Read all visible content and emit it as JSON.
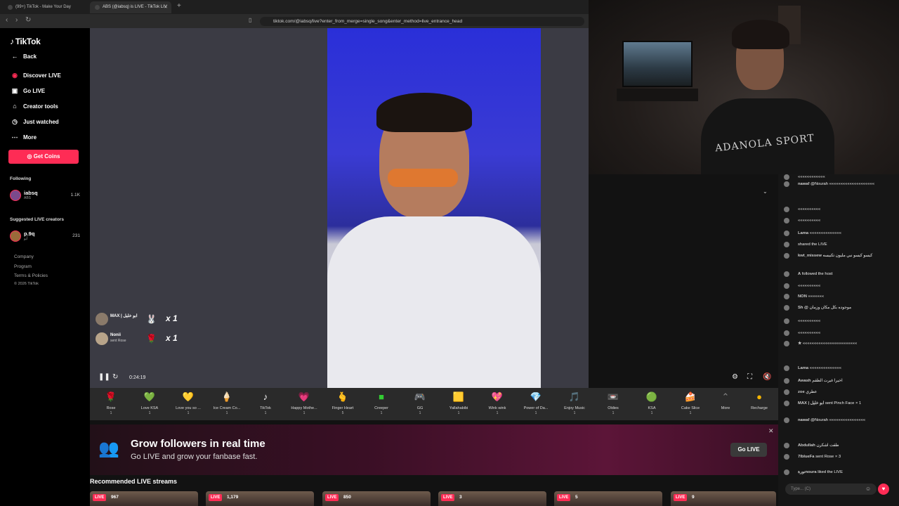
{
  "browser": {
    "tabs": [
      {
        "label": "(99+) TikTok - Make Your Day"
      },
      {
        "label": "ABS (@iabsq) is LIVE - TikTok LIV"
      }
    ],
    "url": "tiktok.com/@iabsq/live?enter_from_merge=single_song&enter_method=live_entrance_head"
  },
  "sidebar": {
    "logo": "TikTok",
    "back": "Back",
    "items": [
      {
        "label": "Discover LIVE",
        "icon": "discover-live-icon"
      },
      {
        "label": "Go LIVE",
        "icon": "camera-icon"
      },
      {
        "label": "Creator tools",
        "icon": "house-icon"
      },
      {
        "label": "Just watched",
        "icon": "clock-icon"
      },
      {
        "label": "More",
        "icon": "dots-icon"
      }
    ],
    "get_coins": "Get Coins",
    "following_title": "Following",
    "following": [
      {
        "name": "iabsq",
        "sub": "ABS",
        "count": "1.1K"
      }
    ],
    "suggested_title": "Suggested LIVE creators",
    "suggested": [
      {
        "name": "p.9q",
        "sub": "أبو",
        "count": "231"
      }
    ],
    "footer": [
      "Company",
      "Program",
      "Terms & Policies",
      "© 2026 TikTok"
    ]
  },
  "player": {
    "gift_popups": [
      {
        "user": "MAX | ابو خليل",
        "sub": "",
        "mult": "x 1"
      },
      {
        "user": "Nonii",
        "sub": "sent Rose",
        "mult": "x 1"
      }
    ],
    "time": "0:24:19"
  },
  "gifts": [
    {
      "label": "Rose",
      "price": "1"
    },
    {
      "label": "Love KSA",
      "price": "1"
    },
    {
      "label": "Love you so ...",
      "price": "1"
    },
    {
      "label": "Ice Cream Co...",
      "price": "1"
    },
    {
      "label": "TikTok",
      "price": "1"
    },
    {
      "label": "Happy Mothe...",
      "price": "1"
    },
    {
      "label": "Finger Heart",
      "price": "5"
    },
    {
      "label": "Creeper",
      "price": "1"
    },
    {
      "label": "GG",
      "price": "1"
    },
    {
      "label": "Yallahabibi",
      "price": "1"
    },
    {
      "label": "Wink wink",
      "price": "1"
    },
    {
      "label": "Power of Da...",
      "price": "1"
    },
    {
      "label": "Enjoy Music",
      "price": "1"
    },
    {
      "label": "Oldies",
      "price": "1"
    },
    {
      "label": "KSA",
      "price": "1"
    },
    {
      "label": "Cake Slice",
      "price": "1"
    }
  ],
  "gift_more": "More",
  "recharge": "Recharge",
  "promo": {
    "title": "Grow followers in real time",
    "subtitle": "Go LIVE and grow your fanbase fast.",
    "button": "Go LIVE"
  },
  "recommended": {
    "title": "Recommended LIVE streams",
    "streams": [
      {
        "badge": "LIVE",
        "viewers": "967"
      },
      {
        "badge": "LIVE",
        "viewers": "1,179"
      },
      {
        "badge": "LIVE",
        "viewers": "850"
      },
      {
        "badge": "LIVE",
        "viewers": "3"
      },
      {
        "badge": "LIVE",
        "viewers": "5"
      },
      {
        "badge": "LIVE",
        "viewers": "9"
      }
    ]
  },
  "webcam": {
    "shirt_text": "ADANOLA SPORT"
  },
  "chat": {
    "messages": [
      {
        "user": "",
        "text": "««««««««««««"
      },
      {
        "user": "nawaf",
        "text": "@Nourah ««««««««««««««««««««"
      },
      {
        "user": "",
        "text": "««««««««««"
      },
      {
        "user": "",
        "text": "««««««««««"
      },
      {
        "user": "Lama",
        "text": "««««««««««««««"
      },
      {
        "user": "",
        "text": "shared the LIVE"
      },
      {
        "user": "kwt_missew",
        "text": "كيسو كيسو نبي مليون تكبيسه"
      },
      {
        "user": "A",
        "text": "followed the host"
      },
      {
        "user": "",
        "text": "««««««««««"
      },
      {
        "user": "NON",
        "text": "«««««««"
      },
      {
        "user": "Sh",
        "text": "@ موجوده بكل مكان وزمان"
      },
      {
        "user": "",
        "text": "««««««««««"
      },
      {
        "user": "",
        "text": "««««««««««"
      },
      {
        "user": "★",
        "text": "««««««««««««««««««««««««"
      },
      {
        "user": "Lama",
        "text": "««««««««««««««"
      },
      {
        "user": "Awash",
        "text": "اخيرا غيرت الطقم"
      },
      {
        "user": "zoe",
        "text": "عطري"
      },
      {
        "user": "MAX | ابو خليل",
        "text": "sent Pinch Face × 1"
      },
      {
        "user": "nawaf",
        "text": "@Nourah ««««««««««««««««"
      },
      {
        "user": "Abdullah",
        "text": "طقت اشكرن"
      },
      {
        "user": "7lblueFa",
        "text": "sent Rose × 3"
      },
      {
        "user": "نورةnoura",
        "text": "liked the LIVE"
      }
    ],
    "input_placeholder": "Type... (C)"
  }
}
